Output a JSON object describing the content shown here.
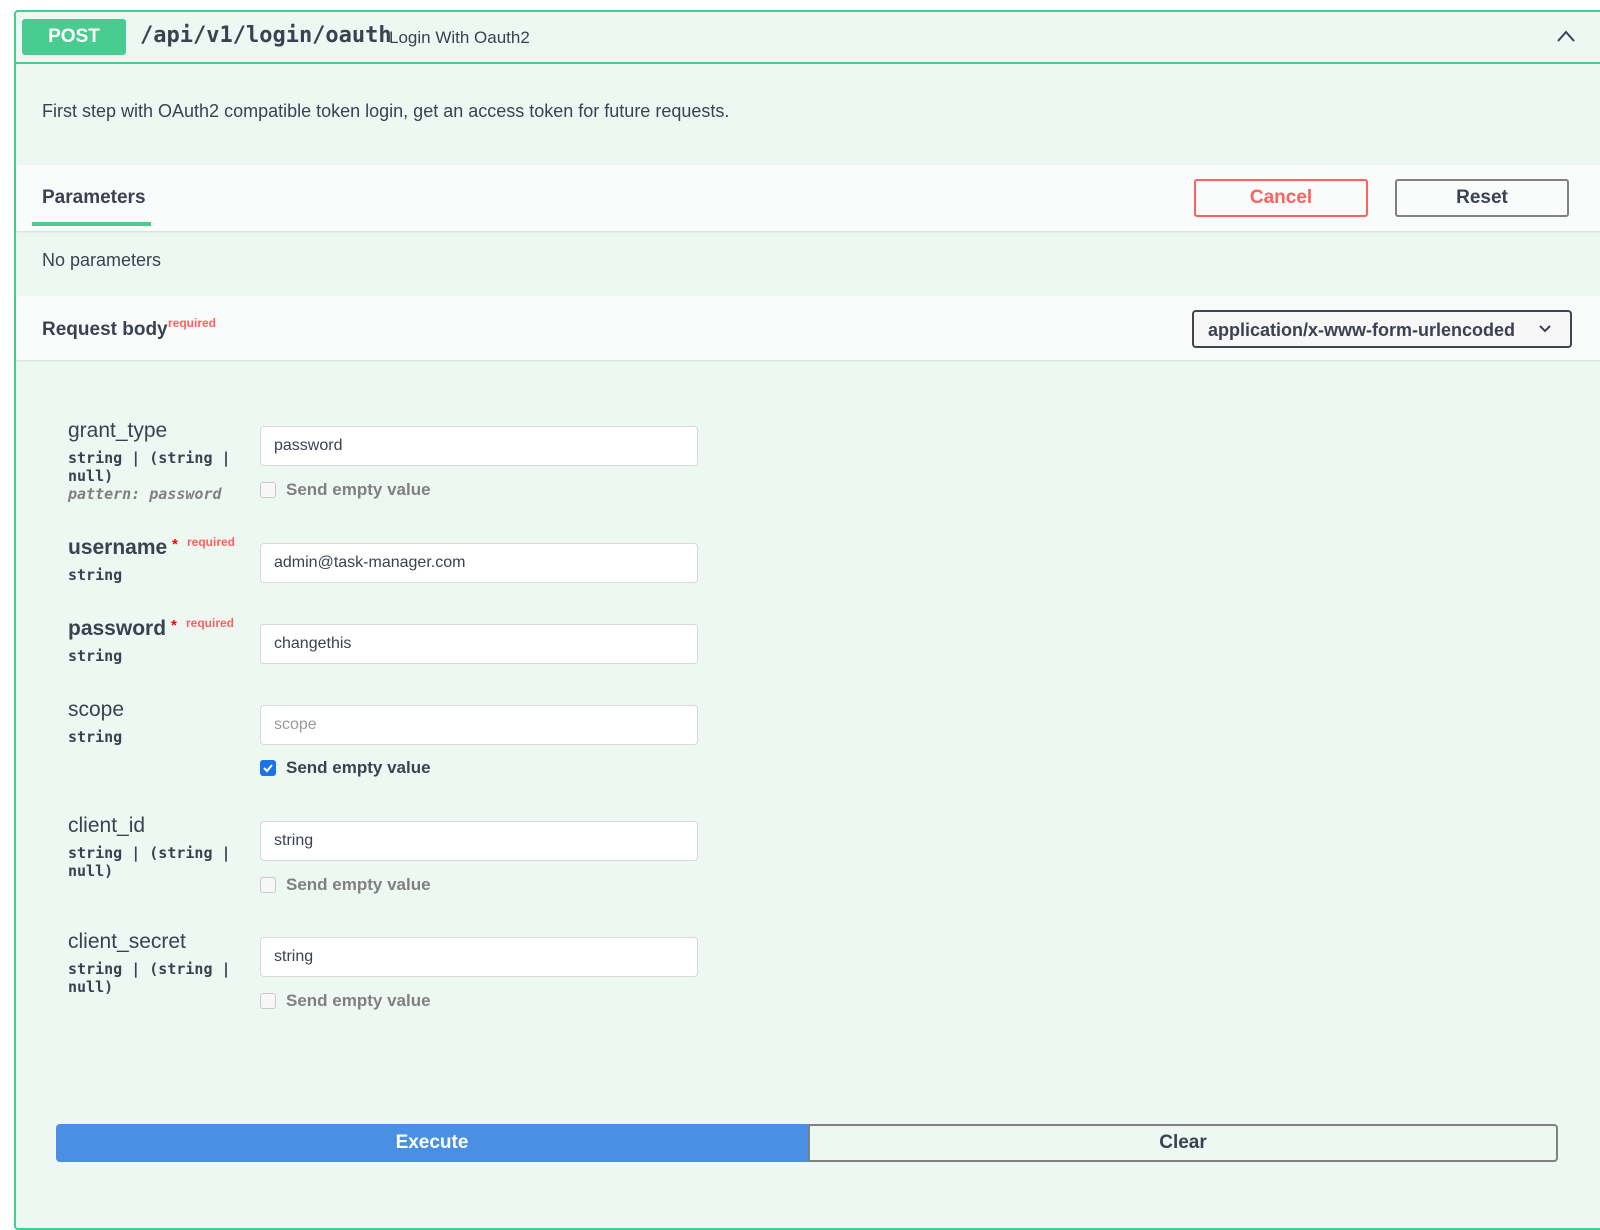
{
  "operation": {
    "method": "POST",
    "path": "/api/v1/login/oauth",
    "summary": "Login With Oauth2",
    "description": "First step with OAuth2 compatible token login, get an access token for future requests."
  },
  "parameters": {
    "tab_label": "Parameters",
    "cancel_label": "Cancel",
    "reset_label": "Reset",
    "empty_text": "No parameters"
  },
  "request_body": {
    "title": "Request body",
    "required_label": "required",
    "content_type": "application/x-www-form-urlencoded",
    "send_empty_label": "Send empty value",
    "fields": [
      {
        "name": "grant_type",
        "type": "string | (string | null)",
        "pattern": "pattern: password",
        "value": "password",
        "placeholder": "",
        "send_empty": false
      },
      {
        "name": "username",
        "required_star": "*",
        "required_label": "required",
        "type": "string",
        "value": "admin@task-manager.com",
        "placeholder": ""
      },
      {
        "name": "password",
        "required_star": "*",
        "required_label": "required",
        "type": "string",
        "value": "changethis",
        "placeholder": ""
      },
      {
        "name": "scope",
        "type": "string",
        "value": "",
        "placeholder": "scope",
        "send_empty": true
      },
      {
        "name": "client_id",
        "type": "string | (string | null)",
        "value": "string",
        "placeholder": "",
        "send_empty": false
      },
      {
        "name": "client_secret",
        "type": "string | (string | null)",
        "value": "string",
        "placeholder": "",
        "send_empty": false
      }
    ]
  },
  "actions": {
    "execute_label": "Execute",
    "clear_label": "Clear"
  },
  "colors": {
    "post_green": "#49cc90",
    "execute_blue": "#4990e2",
    "cancel_red": "#ff6060",
    "text_dark": "#3b4151"
  }
}
